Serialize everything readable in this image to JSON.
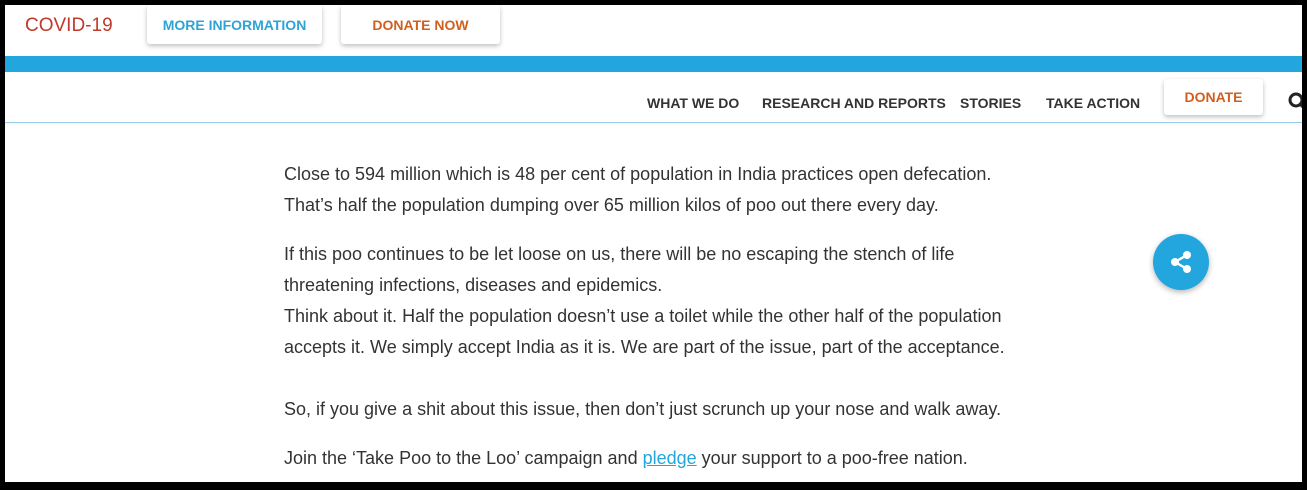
{
  "topbar": {
    "covid_label": "COVID-19",
    "more_info_label": "MORE INFORMATION",
    "donate_now_label": "DONATE NOW"
  },
  "nav": {
    "items": [
      "WHAT WE DO",
      "RESEARCH AND REPORTS",
      "STORIES",
      "TAKE ACTION"
    ],
    "donate_label": "DONATE",
    "search_icon": "search-icon"
  },
  "content": {
    "p1_line1": "Close to 594 million which is 48 per cent of population in India practices open defecation.",
    "p1_line2": "That’s half the population dumping over 65 million kilos of poo out there every day.",
    "p2_line1": "If this poo continues to be let loose on us, there will be no escaping the stench of life",
    "p2_line2": "threatening infections, diseases and epidemics.",
    "p3_line1": "Think about it. Half the population doesn’t use a toilet while the other half of the population",
    "p3_line2": "accepts it. We simply accept India as it is.  We are part of the issue, part of the acceptance.",
    "p4": "So, if you give a shit about this issue, then don’t just scrunch up your nose and walk away.",
    "p5_before": "Join the ‘Take Poo to the Loo’ campaign and ",
    "p5_link": "pledge",
    "p5_after": " your support to a poo-free nation."
  },
  "share": {
    "icon": "share-icon"
  },
  "colors": {
    "accent_blue": "#22a6dd",
    "donate_orange": "#d0601e",
    "covid_red": "#c0392b"
  }
}
